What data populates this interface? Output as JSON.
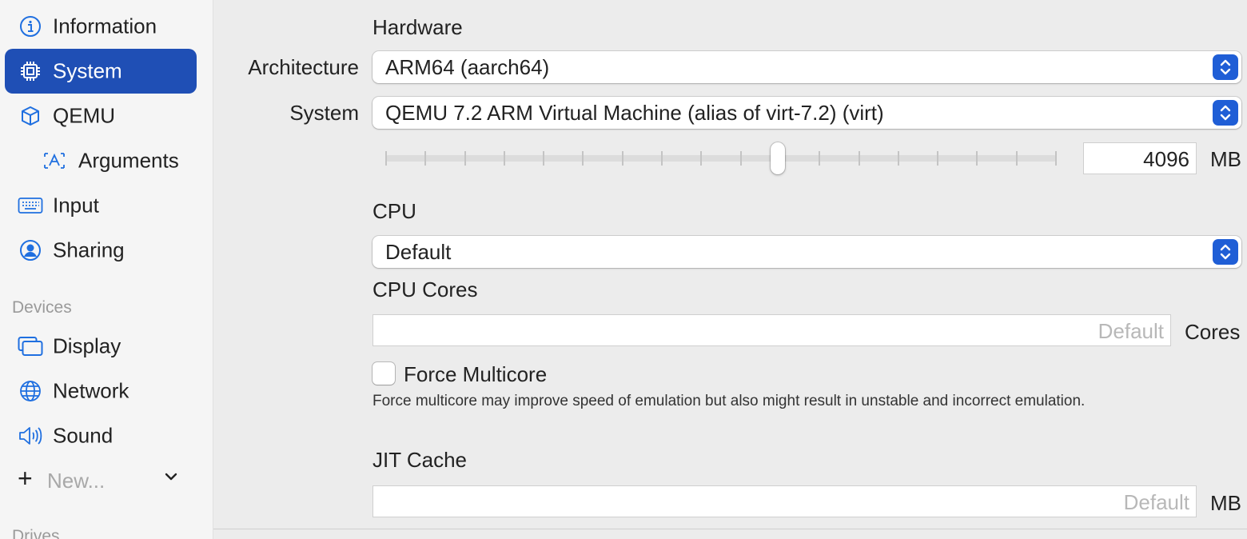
{
  "sidebar": {
    "items": [
      {
        "label": "Information",
        "icon": "info-circle-icon"
      },
      {
        "label": "System",
        "icon": "cpu-chip-icon",
        "selected": true
      },
      {
        "label": "QEMU",
        "icon": "cube-icon"
      },
      {
        "label": "Arguments",
        "icon": "text-cursor-icon",
        "indent": true
      },
      {
        "label": "Input",
        "icon": "keyboard-icon"
      },
      {
        "label": "Sharing",
        "icon": "person-circle-icon"
      }
    ],
    "devices_heading": "Devices",
    "devices": [
      {
        "label": "Display",
        "icon": "display-windows-icon"
      },
      {
        "label": "Network",
        "icon": "globe-icon"
      },
      {
        "label": "Sound",
        "icon": "speaker-icon"
      }
    ],
    "new_label": "New...",
    "drives_heading": "Drives"
  },
  "hardware": {
    "heading": "Hardware",
    "architecture_label": "Architecture",
    "architecture_value": "ARM64 (aarch64)",
    "system_label": "System",
    "system_value": "QEMU 7.2 ARM Virtual Machine (alias of virt-7.2) (virt)",
    "memory_value": "4096",
    "memory_unit": "MB",
    "memory_slider_fraction": 0.585
  },
  "cpu": {
    "heading": "CPU",
    "value": "Default",
    "cores_heading": "CPU Cores",
    "cores_placeholder": "Default",
    "cores_unit": "Cores",
    "force_multicore_label": "Force Multicore",
    "force_multicore_checked": false,
    "force_multicore_help": "Force multicore may improve speed of emulation but also might result in unstable and incorrect emulation."
  },
  "jit": {
    "heading": "JIT Cache",
    "placeholder": "Default",
    "unit": "MB"
  },
  "colors": {
    "accent": "#1f4fb5",
    "popup_button": "#1f5ed6",
    "sidebar_bg": "#f5f5f5",
    "window_bg": "#ececec"
  }
}
